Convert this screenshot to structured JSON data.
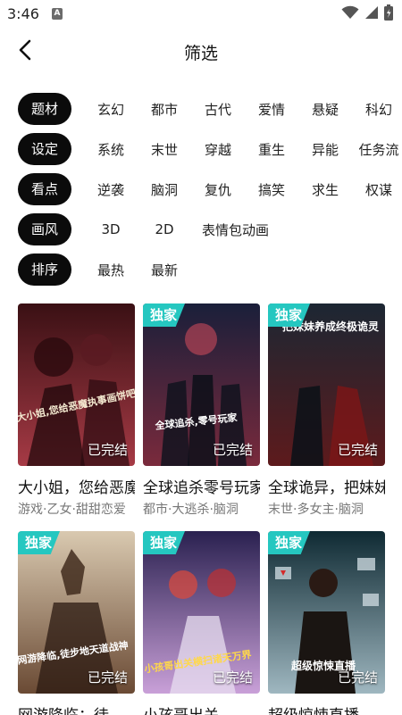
{
  "status_bar": {
    "time": "3:46",
    "app_icon_label": "A",
    "icons": [
      "wifi-icon",
      "signal-icon",
      "battery-icon"
    ]
  },
  "header": {
    "title": "筛选",
    "back_icon": "chevron-left-icon"
  },
  "filters": [
    {
      "label": "题材",
      "options": [
        "玄幻",
        "都市",
        "古代",
        "爱情",
        "悬疑",
        "科幻"
      ]
    },
    {
      "label": "设定",
      "options": [
        "系统",
        "末世",
        "穿越",
        "重生",
        "异能",
        "任务流"
      ]
    },
    {
      "label": "看点",
      "options": [
        "逆袭",
        "脑洞",
        "复仇",
        "搞笑",
        "求生",
        "权谋"
      ]
    },
    {
      "label": "画风",
      "options": [
        "3D",
        "2D",
        "表情包动画"
      ]
    },
    {
      "label": "排序",
      "options": [
        "最热",
        "最新"
      ]
    }
  ],
  "cards": [
    {
      "title": "大小姐，您给恶魔…",
      "tags": "游戏·乙女·甜甜恋爱",
      "badge": "",
      "status": "已完结",
      "cover_caption": "大小姐,您给恶魔执事画饼吧",
      "colors": [
        "#3a1014",
        "#a63a45"
      ]
    },
    {
      "title": "全球追杀零号玩家",
      "tags": "都市·大逃杀·脑洞",
      "badge": "独家",
      "status": "已完结",
      "cover_caption": "全球追杀,零号玩家",
      "colors": [
        "#1a1f3a",
        "#7a2a3c"
      ]
    },
    {
      "title": "全球诡异，把妹妹…",
      "tags": "末世·多女主·脑洞",
      "badge": "独家",
      "status": "已完结",
      "cover_caption": "把妹妹养成终极诡灵",
      "colors": [
        "#1c2733",
        "#5d1a1c"
      ]
    },
    {
      "title": "网游降临：徒…",
      "tags": "",
      "badge": "独家",
      "status": "已完结",
      "cover_caption": "网游降临,徒步地天道战神",
      "colors": [
        "#d9c9b0",
        "#6a4a34"
      ]
    },
    {
      "title": "小孩哥出关…",
      "tags": "",
      "badge": "独家",
      "status": "已完结",
      "cover_caption": "小孩哥出关横扫诸天万界",
      "colors": [
        "#2a2150",
        "#c9a0d8"
      ]
    },
    {
      "title": "超级惊悚直播",
      "tags": "",
      "badge": "独家",
      "status": "已完结",
      "cover_caption": "超级惊悚直播",
      "colors": [
        "#0f2a33",
        "#9fb7c0"
      ]
    }
  ]
}
